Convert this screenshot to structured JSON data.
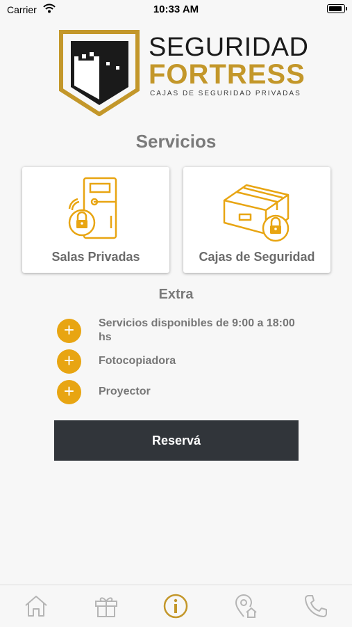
{
  "status_bar": {
    "carrier": "Carrier",
    "time": "10:33 AM"
  },
  "brand": {
    "line1": "SEGURIDAD",
    "line2": "FORTRESS",
    "tagline": "CAJAS DE SEGURIDAD PRIVADAS",
    "gold_color": "#c3972a"
  },
  "services": {
    "title": "Servicios",
    "cards": [
      {
        "label": "Salas Privadas",
        "icon": "private-room-door-lock-icon"
      },
      {
        "label": "Cajas de Seguridad",
        "icon": "safe-box-lock-icon"
      }
    ]
  },
  "extra": {
    "title": "Extra",
    "items": [
      {
        "text": "Servicios disponibles de 9:00 a 18:00 hs"
      },
      {
        "text": "Fotocopiadora"
      },
      {
        "text": "Proyector"
      }
    ],
    "accent_color": "#e8a512"
  },
  "reserve_button": {
    "label": "Reservá",
    "color": "#31353a"
  },
  "tab_bar": {
    "tabs": [
      {
        "icon": "home-icon",
        "active": false
      },
      {
        "icon": "gift-icon",
        "active": false
      },
      {
        "icon": "info-icon",
        "active": true
      },
      {
        "icon": "location-home-icon",
        "active": false
      },
      {
        "icon": "phone-icon",
        "active": false
      }
    ]
  }
}
